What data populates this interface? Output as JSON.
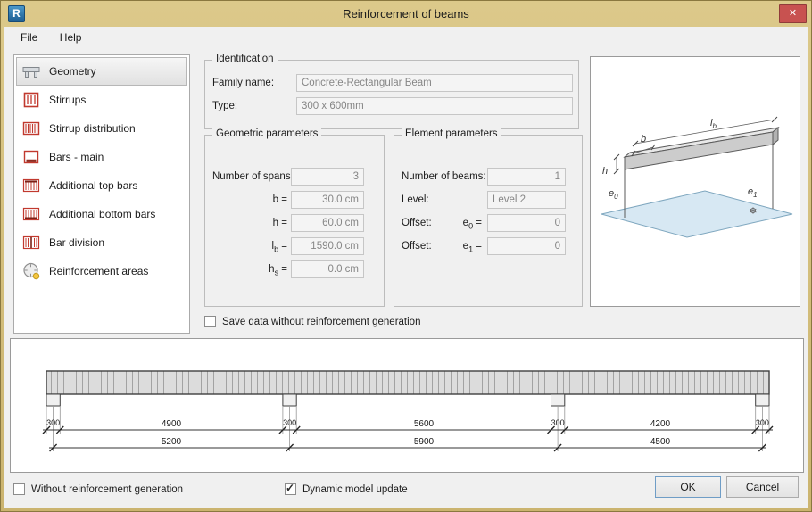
{
  "window": {
    "title": "Reinforcement of beams",
    "close_glyph": "✕",
    "app_initial": "R"
  },
  "menu": {
    "file": "File",
    "help": "Help"
  },
  "sidebar": {
    "items": [
      {
        "label": "Geometry",
        "selected": true
      },
      {
        "label": "Stirrups",
        "selected": false
      },
      {
        "label": "Stirrup distribution",
        "selected": false
      },
      {
        "label": "Bars - main",
        "selected": false
      },
      {
        "label": "Additional top bars",
        "selected": false
      },
      {
        "label": "Additional bottom bars",
        "selected": false
      },
      {
        "label": "Bar division",
        "selected": false
      },
      {
        "label": "Reinforcement areas",
        "selected": false
      }
    ]
  },
  "identification": {
    "title": "Identification",
    "family_label": "Family name:",
    "family_value": "Concrete-Rectangular Beam",
    "type_label": "Type:",
    "type_value": "300 x 600mm"
  },
  "geometric": {
    "title": "Geometric parameters",
    "spans_label": "Number of spans:",
    "spans_value": "3",
    "rows": [
      {
        "base": "b",
        "sub": "",
        "eq": "=",
        "value": "30.0 cm"
      },
      {
        "base": "h",
        "sub": "",
        "eq": "=",
        "value": "60.0 cm"
      },
      {
        "base": "l",
        "sub": "b",
        "eq": "=",
        "value": "1590.0 cm"
      },
      {
        "base": "h",
        "sub": "s",
        "eq": "=",
        "value": "0.0 cm"
      }
    ]
  },
  "element": {
    "title": "Element parameters",
    "beams_label": "Number of beams:",
    "beams_value": "1",
    "level_label": "Level:",
    "level_value": "Level 2",
    "offset0": {
      "label": "Offset:",
      "base": "e",
      "sub": "0",
      "eq": "=",
      "value": "0"
    },
    "offset1": {
      "label": "Offset:",
      "base": "e",
      "sub": "1",
      "eq": "=",
      "value": "0"
    }
  },
  "save_checkbox": {
    "label": "Save data without reinforcement generation",
    "checked": false,
    "glyph": ""
  },
  "preview": {
    "b": "b",
    "lb_base": "l",
    "lb_sub": "b",
    "h": "h",
    "e0_base": "e",
    "e0_sub": "0",
    "e1_base": "e",
    "e1_sub": "1"
  },
  "elevation": {
    "row1": [
      "300",
      "4900",
      "300",
      "5600",
      "300",
      "4200",
      "300"
    ],
    "row2": [
      "5200",
      "5900",
      "4500"
    ]
  },
  "footer": {
    "without_checkbox": {
      "label": "Without reinforcement generation",
      "checked": false,
      "glyph": ""
    },
    "dynamic_checkbox": {
      "label": "Dynamic model update",
      "checked": true,
      "glyph": "✓"
    },
    "ok": "OK",
    "cancel": "Cancel"
  }
}
